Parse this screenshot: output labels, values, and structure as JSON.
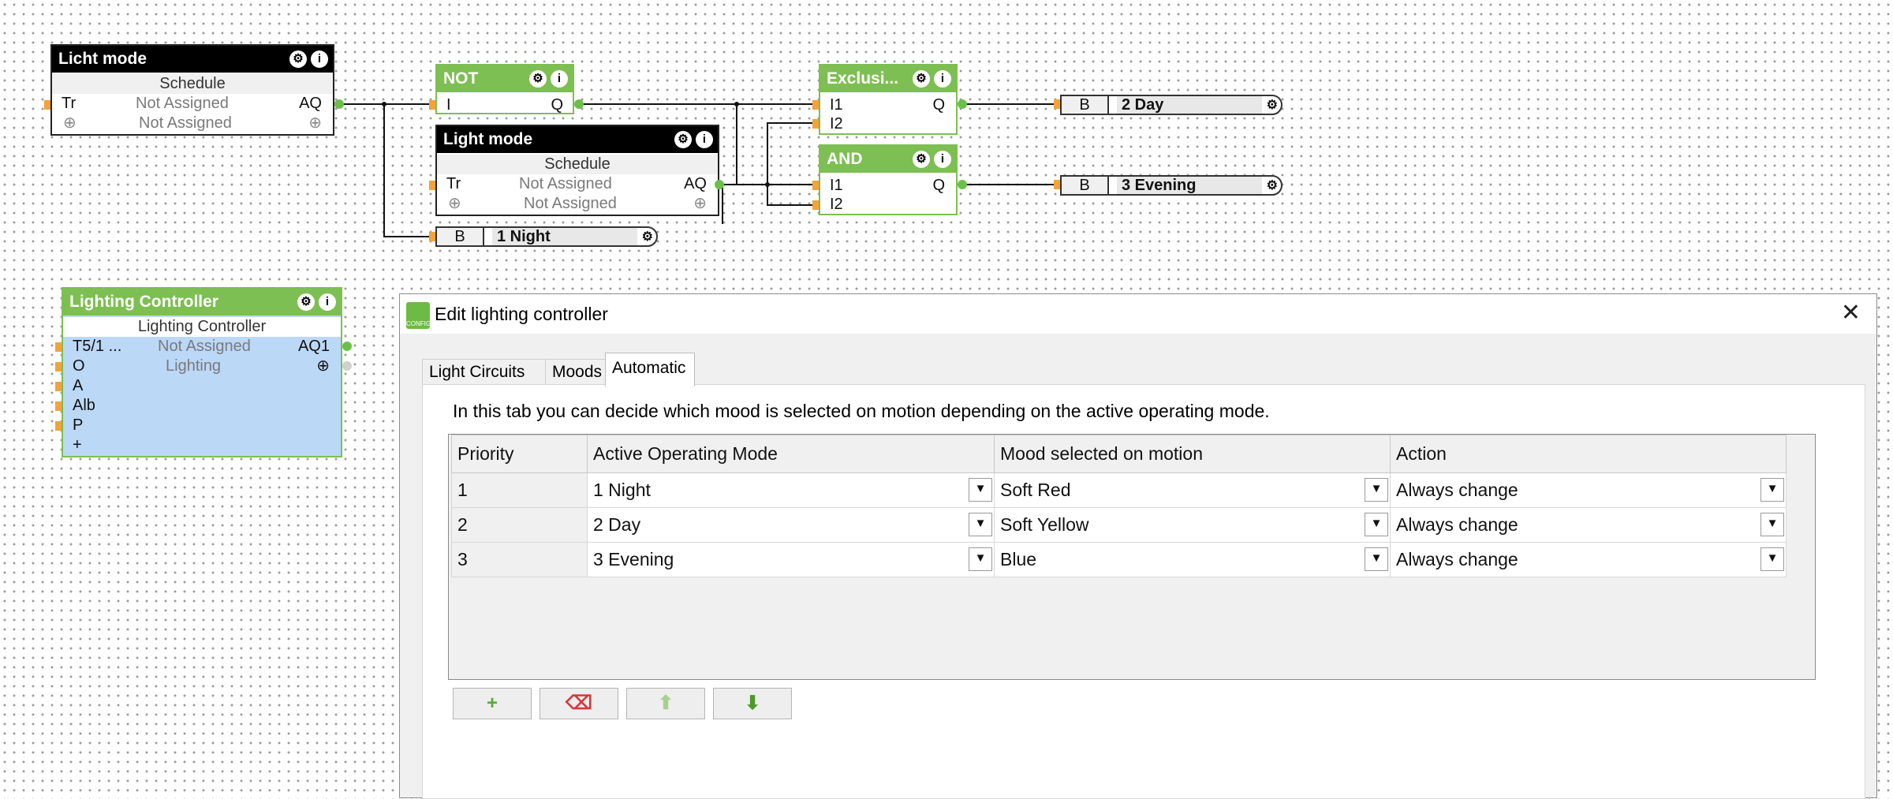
{
  "blocks": {
    "licht_mode": {
      "title": "Licht mode",
      "subtitle": "Schedule",
      "in1": "Tr",
      "val1": "Not Assigned",
      "out1": "AQ",
      "val2": "Not Assigned"
    },
    "not_block": {
      "title": "NOT",
      "in1": "I",
      "out1": "Q"
    },
    "light_mode": {
      "title": "Light mode",
      "subtitle": "Schedule",
      "in1": "Tr",
      "val1": "Not Assigned",
      "out1": "AQ",
      "val2": "Not Assigned"
    },
    "exclusive": {
      "title": "Exclusi...",
      "in1": "I1",
      "in2": "I2",
      "out1": "Q"
    },
    "and_block": {
      "title": "AND",
      "in1": "I1",
      "in2": "I2",
      "out1": "Q"
    },
    "lighting_controller": {
      "title": "Lighting Controller",
      "subtitle": "Lighting Controller",
      "in1": "T5/1 ...",
      "val1": "Not Assigned",
      "out1": "AQ1",
      "in2": "O",
      "val2": "Lighting",
      "in3": "A",
      "in4": "Alb",
      "in5": "P",
      "add": "+"
    }
  },
  "memory_flags": [
    {
      "type": "B",
      "label": "2 Day"
    },
    {
      "type": "B",
      "label": "3 Evening"
    },
    {
      "type": "B",
      "label": "1 Night"
    }
  ],
  "dialog": {
    "title": "Edit lighting controller",
    "close": "✕",
    "app_icon_text": "CONFIG",
    "tabs": [
      {
        "label": "Light Circuits"
      },
      {
        "label": "Moods"
      },
      {
        "label": "Automatic"
      }
    ],
    "active_tab": "Automatic",
    "description": "In this tab you can decide which mood is selected on motion depending on the active operating mode.",
    "table": {
      "headers": [
        "Priority",
        "Active Operating Mode",
        "Mood selected on motion",
        "Action"
      ],
      "rows": [
        {
          "priority": "1",
          "mode": "1 Night",
          "mood": "Soft Red",
          "action": "Always change"
        },
        {
          "priority": "2",
          "mode": "2 Day",
          "mood": "Soft Yellow",
          "action": "Always change"
        },
        {
          "priority": "3",
          "mode": "3 Evening",
          "mood": "Blue",
          "action": "Always change"
        }
      ]
    },
    "buttons": [
      {
        "name": "add",
        "glyph": "+"
      },
      {
        "name": "erase",
        "glyph": "⌫"
      },
      {
        "name": "move-up",
        "glyph": "⬆"
      },
      {
        "name": "move-down",
        "glyph": "⬇"
      }
    ]
  },
  "colors": {
    "block_green": "#7dbf52",
    "block_black": "#000000",
    "wire_green": "#6cc04a",
    "input_port": "#f2a33a",
    "controller_body": "#bcd8f7"
  }
}
